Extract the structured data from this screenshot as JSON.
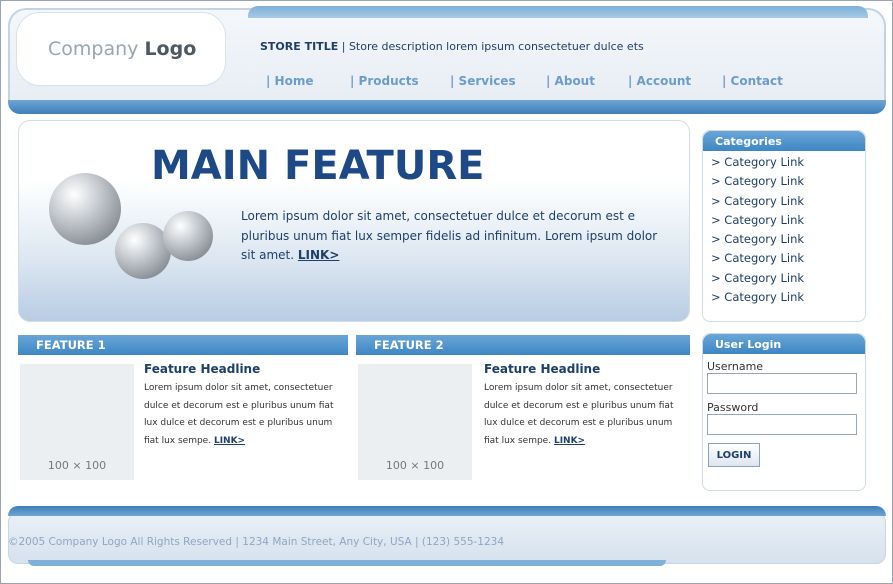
{
  "header": {
    "logo_light": "Company",
    "logo_bold": "Logo",
    "store_title": "STORE TITLE",
    "store_separator": "|",
    "store_description": "Store description lorem ipsum consectetuer dulce ets"
  },
  "nav": {
    "items": [
      {
        "label": "| Home"
      },
      {
        "label": "| Products"
      },
      {
        "label": "| Services"
      },
      {
        "label": "| About"
      },
      {
        "label": "| Account"
      },
      {
        "label": "| Contact"
      }
    ]
  },
  "hero": {
    "title": "MAIN FEATURE",
    "text": "Lorem ipsum dolor sit amet, consectetuer dulce et decorum est e pluribus unum fiat lux semper fidelis ad infinitum. Lorem ipsum dolor sit amet.",
    "link": "LINK>"
  },
  "sidebar": {
    "categories_title": "Categories",
    "categories": [
      "> Category Link",
      "> Category Link",
      "> Category Link",
      "> Category Link",
      "> Category Link",
      "> Category Link",
      "> Category Link",
      "> Category Link"
    ],
    "login_title": "User Login",
    "username_label": "Username",
    "password_label": "Password",
    "login_button": "LOGIN"
  },
  "features": [
    {
      "bar_label": "FEATURE 1",
      "thumb_label": "100 × 100",
      "headline": "Feature Headline",
      "body": "Lorem ipsum dolor sit amet, consectetuer dulce et decorum est e pluribus unum fiat lux dulce et decorum est e pluribus unum fiat lux sempe.",
      "link": "LINK>"
    },
    {
      "bar_label": "FEATURE 2",
      "thumb_label": "100 × 100",
      "headline": "Feature Headline",
      "body": "Lorem ipsum dolor sit amet, consectetuer dulce et decorum est e pluribus unum fiat lux dulce et decorum est e pluribus unum fiat lux sempe.",
      "link": "LINK>"
    }
  ],
  "footer": {
    "text": "©2005 Company Logo All Rights Reserved | 1234 Main Street, Any City, USA | (123) 555-1234"
  },
  "colors": {
    "accent": "#3e86c4",
    "title": "#1d4a86",
    "nav": "#6a9ccd"
  }
}
